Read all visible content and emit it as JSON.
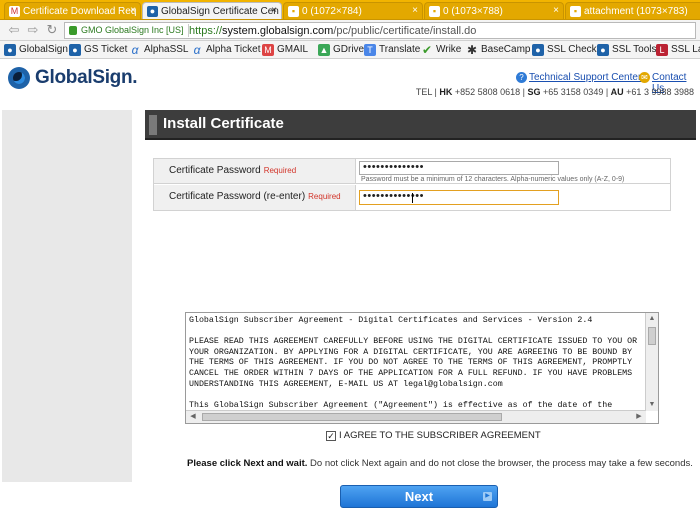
{
  "tabs": [
    {
      "label": "Certificate Download Req",
      "icon": "gmail-icon",
      "active": false
    },
    {
      "label": "GlobalSign Certificate Cen",
      "icon": "globalsign-icon",
      "active": true
    },
    {
      "label": "0 (1072×784)",
      "icon": "image-icon",
      "active": false
    },
    {
      "label": "0 (1073×788)",
      "icon": "image-icon",
      "active": false
    },
    {
      "label": "attachment (1073×783)",
      "icon": "image-icon",
      "active": false
    }
  ],
  "address": {
    "ev_label": "GMO GlobalSign Inc [US]",
    "url_host": "system.globalsign.com",
    "url_path": "/pc/public/certificate/install.do",
    "url_scheme": "https://"
  },
  "bookmarks": [
    {
      "label": "GlobalSign",
      "icon": "globalsign-icon"
    },
    {
      "label": "GS Ticket",
      "icon": "globalsign-icon"
    },
    {
      "label": "AlphaSSL",
      "icon": "alpha-icon"
    },
    {
      "label": "Alpha Ticket",
      "icon": "alpha-icon"
    },
    {
      "label": "GMAIL",
      "icon": "gmail-icon"
    },
    {
      "label": "GDrive",
      "icon": "gdrive-icon"
    },
    {
      "label": "Translate",
      "icon": "translate-icon"
    },
    {
      "label": "Wrike",
      "icon": "wrike-icon"
    },
    {
      "label": "BaseCamp",
      "icon": "basecamp-icon"
    },
    {
      "label": "SSL Check",
      "icon": "globalsign-icon"
    },
    {
      "label": "SSL Tools",
      "icon": "globalsign-icon"
    },
    {
      "label": "SSL Lab",
      "icon": "lab-icon"
    }
  ],
  "header": {
    "logo_text": "GlobalSign.",
    "support_link": "Technical Support Center",
    "contact_link": "Contact Us",
    "tel_prefix": "TEL | ",
    "tel_hk_label": "HK",
    "tel_hk": " +852 5808 0618 | ",
    "tel_sg_label": "SG",
    "tel_sg": " +65 3158 0349 | ",
    "tel_au_label": "AU",
    "tel_au": " +61 3 9988 3988"
  },
  "main": {
    "title": "Install Certificate",
    "form": {
      "password_label": "Certificate Password",
      "password_required": "Required",
      "password_value": "••••••••••••••",
      "password_hint": "Password must be a minimum of 12 characters. Alpha-numeric values only (A-Z, 0-9)",
      "reenter_label": "Certificate Password (re-enter)",
      "reenter_required": "Required",
      "reenter_value": "••••••••••••••"
    },
    "agreement_text": "GlobalSign Subscriber Agreement - Digital Certificates and Services - Version 2.4\n\nPLEASE READ THIS AGREEMENT CAREFULLY BEFORE USING THE DIGITAL CERTIFICATE ISSUED TO YOU OR\nYOUR ORGANIZATION. BY APPLYING FOR A DIGITAL CERTIFICATE, YOU ARE AGREEING TO BE BOUND BY\nTHE TERMS OF THIS AGREEMENT. IF YOU DO NOT AGREE TO THE TERMS OF THIS AGREEMENT, PROMPTLY\nCANCEL THE ORDER WITHIN 7 DAYS OF THE APPLICATION FOR A FULL REFUND. IF YOU HAVE PROBLEMS\nUNDERSTANDING THIS AGREEMENT, E-MAIL US AT legal@globalsign.com\n\nThis GlobalSign Subscriber Agreement (\"Agreement\") is effective as of the date of the",
    "agree_checked": true,
    "agree_label": "I AGREE TO THE SUBSCRIBER AGREEMENT",
    "note_bold": "Please click Next and wait.",
    "note_rest": " Do not click Next again and do not close the browser, the process may take a few seconds.",
    "next_label": "Next"
  },
  "colors": {
    "tabbar": "#f2b400",
    "header_bar": "#3d3d3d",
    "required": "#d2352a",
    "next_button": "#1e74d6",
    "link": "#1a4fb0"
  }
}
